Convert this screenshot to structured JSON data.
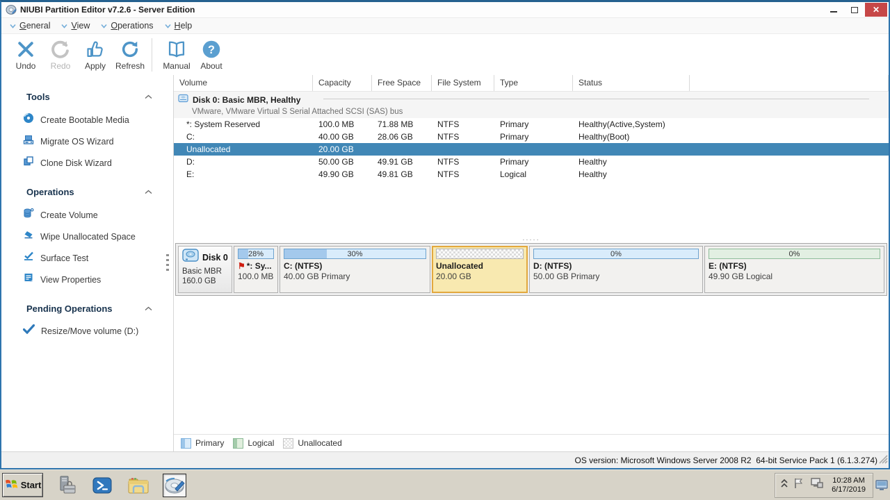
{
  "window": {
    "title": "NIUBI Partition Editor v7.2.6 - Server Edition",
    "controls": {
      "close_glyph": "✕"
    }
  },
  "menu": {
    "items": [
      {
        "label": "General"
      },
      {
        "label": "View"
      },
      {
        "label": "Operations"
      },
      {
        "label": "Help"
      }
    ]
  },
  "toolbar": {
    "buttons": [
      {
        "label": "Undo",
        "enabled": true
      },
      {
        "label": "Redo",
        "enabled": false
      },
      {
        "label": "Apply",
        "enabled": true
      },
      {
        "label": "Refresh",
        "enabled": true
      },
      {
        "label": "Manual",
        "enabled": true
      },
      {
        "label": "About",
        "enabled": true
      }
    ]
  },
  "sidebar": {
    "sections": [
      {
        "title": "Tools",
        "items": [
          {
            "label": "Create Bootable Media",
            "icon": "bootable-media-disc-icon"
          },
          {
            "label": "Migrate OS Wizard",
            "icon": "migrate-os-icon"
          },
          {
            "label": "Clone Disk Wizard",
            "icon": "clone-disk-icon"
          }
        ]
      },
      {
        "title": "Operations",
        "items": [
          {
            "label": "Create Volume",
            "icon": "create-volume-icon"
          },
          {
            "label": "Wipe Unallocated Space",
            "icon": "wipe-icon"
          },
          {
            "label": "Surface Test",
            "icon": "surface-test-icon"
          },
          {
            "label": "View Properties",
            "icon": "view-properties-icon"
          }
        ]
      },
      {
        "title": "Pending Operations",
        "items": [
          {
            "label": "Resize/Move volume (D:)",
            "icon": "pending-check-icon"
          }
        ]
      }
    ]
  },
  "volume_table": {
    "columns": [
      "Volume",
      "Capacity",
      "Free Space",
      "File System",
      "Type",
      "Status"
    ],
    "disk_group": {
      "title": "Disk 0: Basic MBR, Healthy",
      "subtitle": "VMware, VMware Virtual S Serial Attached SCSI (SAS) bus"
    },
    "rows": [
      {
        "volume": "*: System Reserved",
        "capacity": "100.0 MB",
        "free_space": "71.88 MB",
        "file_system": "NTFS",
        "type": "Primary",
        "status": "Healthy(Active,System)"
      },
      {
        "volume": "C:",
        "capacity": "40.00 GB",
        "free_space": "28.06 GB",
        "file_system": "NTFS",
        "type": "Primary",
        "status": "Healthy(Boot)"
      },
      {
        "volume": "Unallocated",
        "capacity": "20.00 GB",
        "free_space": "",
        "file_system": "",
        "type": "",
        "status": ""
      },
      {
        "volume": "D:",
        "capacity": "50.00 GB",
        "free_space": "49.91 GB",
        "file_system": "NTFS",
        "type": "Primary",
        "status": "Healthy"
      },
      {
        "volume": "E:",
        "capacity": "49.90 GB",
        "free_space": "49.81 GB",
        "file_system": "NTFS",
        "type": "Logical",
        "status": "Healthy"
      }
    ],
    "splitter_dots": "....."
  },
  "disk_map": {
    "disk": {
      "name": "Disk 0",
      "layout": "Basic MBR",
      "size": "160.0 GB"
    },
    "partitions": [
      {
        "percent": "28%",
        "label": "*: Sy...",
        "detail": "100.0 MB",
        "kind": "primary",
        "used_percent": 28,
        "flagged": true,
        "selected": false
      },
      {
        "percent": "30%",
        "label": "C: (NTFS)",
        "detail": "40.00 GB Primary",
        "kind": "primary",
        "used_percent": 30,
        "flagged": false,
        "selected": false
      },
      {
        "percent": "",
        "label": "Unallocated",
        "detail": "20.00 GB",
        "kind": "unallocated",
        "flagged": false,
        "selected": true
      },
      {
        "percent": "0%",
        "label": "D: (NTFS)",
        "detail": "50.00 GB Primary",
        "kind": "primary",
        "used_percent": 0,
        "flagged": false,
        "selected": false
      },
      {
        "percent": "0%",
        "label": "E: (NTFS)",
        "detail": "49.90 GB Logical",
        "kind": "logical",
        "used_percent": 0,
        "flagged": false,
        "selected": false
      }
    ]
  },
  "legend": {
    "items": [
      {
        "label": "Primary",
        "kind": "primary"
      },
      {
        "label": "Logical",
        "kind": "logical"
      },
      {
        "label": "Unallocated",
        "kind": "unallocated"
      }
    ]
  },
  "status_bar": {
    "text": "OS version: Microsoft Windows Server 2008 R2  64-bit Service Pack 1 (6.1.3.274)"
  },
  "taskbar": {
    "start_label": "Start",
    "clock": {
      "time": "10:28 AM",
      "date": "6/17/2019"
    }
  },
  "icons": {
    "flag_glyph": "⚑",
    "tray_flag_glyph": "⚐"
  },
  "colors": {
    "window_border": "#2e74ad",
    "selected_row": "#4187b6",
    "selected_block_border": "#e2a83e",
    "selected_block_bg": "#f8e9b0",
    "toolbar_icon_blue": "#4e95c8",
    "sidebar_icon_blue": "#2e79ba",
    "close_button": "#c64747"
  }
}
